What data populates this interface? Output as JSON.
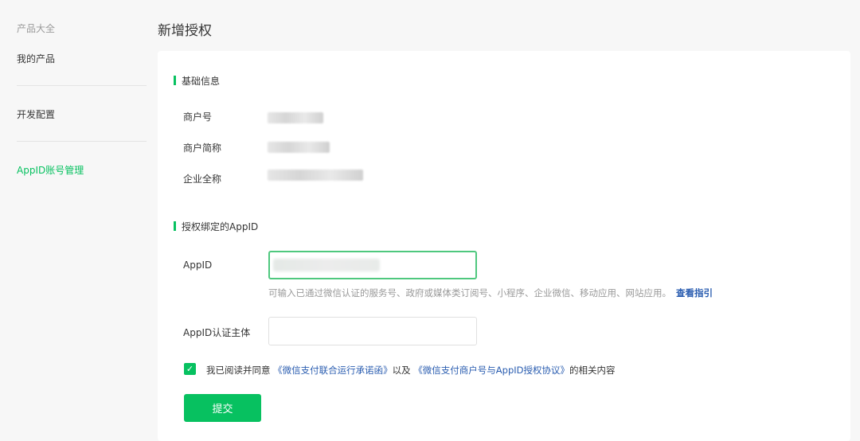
{
  "sidebar": {
    "items": [
      {
        "label": "产品大全"
      },
      {
        "label": "我的产品"
      },
      {
        "label": "开发配置"
      },
      {
        "label": "AppID账号管理"
      }
    ]
  },
  "page": {
    "title": "新增授权"
  },
  "basic": {
    "heading": "基础信息",
    "fields": [
      {
        "label": "商户号"
      },
      {
        "label": "商户简称"
      },
      {
        "label": "企业全称"
      }
    ]
  },
  "bind": {
    "heading": "授权绑定的AppID",
    "appid_label": "AppID",
    "appid_hint": "可输入已通过微信认证的服务号、政府或媒体类订阅号、小程序、企业微信、移动应用、网站应用。",
    "guide_link": "查看指引",
    "subject_label": "AppID认证主体",
    "subject_value": ""
  },
  "agreement": {
    "checked": true,
    "prefix": "我已阅读并同意",
    "link1": "《微信支付联合运行承诺函》",
    "middle": "以及",
    "link2": "《微信支付商户号与AppID授权协议》",
    "suffix": "的相关内容"
  },
  "submit_label": "提交",
  "colors": {
    "accent": "#07c160",
    "link": "#2a5db0"
  }
}
